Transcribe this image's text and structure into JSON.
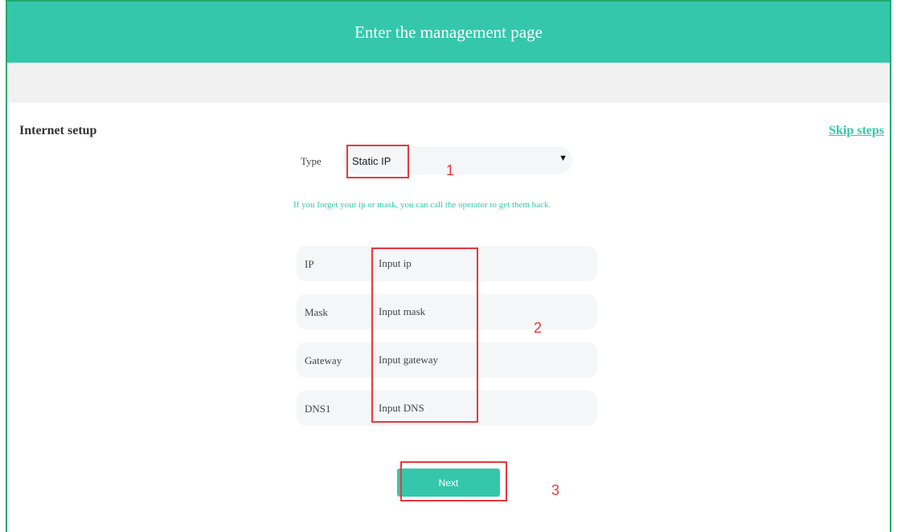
{
  "header": {
    "title": "Enter the management page"
  },
  "section": {
    "title": "Internet setup",
    "skip_label": "Skip steps"
  },
  "type_field": {
    "label": "Type",
    "selected": "Static IP",
    "arrow": "▼"
  },
  "hint": "If you forget your ip or mask, you can call the operator to get them back.",
  "fields": [
    {
      "label": "IP",
      "placeholder": "Input ip"
    },
    {
      "label": "Mask",
      "placeholder": "Input mask"
    },
    {
      "label": "Gateway",
      "placeholder": "Input gateway"
    },
    {
      "label": "DNS1",
      "placeholder": "Input DNS"
    }
  ],
  "next_label": "Next",
  "annotations": [
    "1",
    "2",
    "3"
  ],
  "colors": {
    "accent": "#34c7ab",
    "annotation": "#e8383d",
    "frame": "#22a86c"
  }
}
